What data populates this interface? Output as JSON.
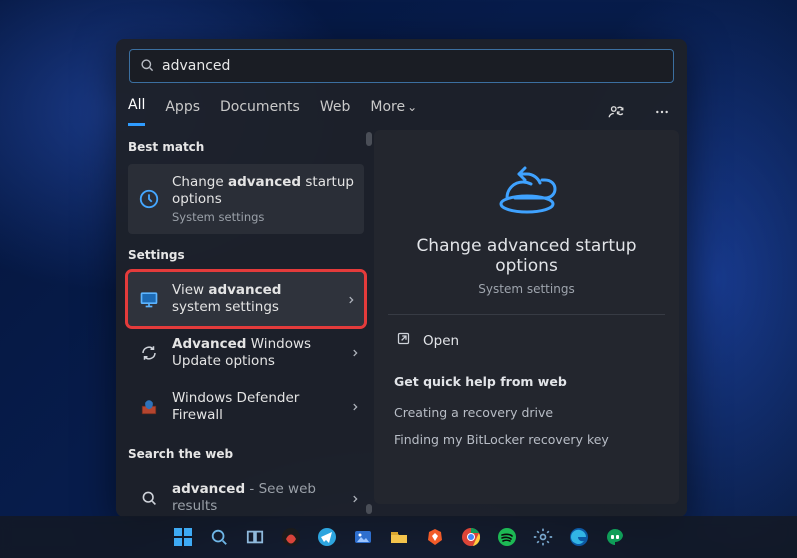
{
  "search": {
    "query": "advanced"
  },
  "tabs": {
    "items": [
      "All",
      "Apps",
      "Documents",
      "Web",
      "More"
    ],
    "active": 0
  },
  "sections": {
    "best_match": "Best match",
    "settings": "Settings",
    "search_web": "Search the web"
  },
  "results": {
    "best": {
      "title_pre": "Change ",
      "title_bold": "advanced",
      "title_post": " startup options",
      "sub": "System settings"
    },
    "settings": [
      {
        "title_pre": "View ",
        "title_bold": "advanced",
        "title_post": " system settings",
        "sub": ""
      },
      {
        "title_pre": "",
        "title_bold": "Advanced",
        "title_post": " Windows Update options",
        "sub": ""
      },
      {
        "title_pre": "Windows Defender Firewall",
        "title_bold": "",
        "title_post": "",
        "sub": ""
      }
    ],
    "web": {
      "title_bold": "advanced",
      "title_post": " - See web results"
    }
  },
  "details": {
    "title": "Change advanced startup options",
    "sub": "System settings",
    "open_label": "Open",
    "help_header": "Get quick help from web",
    "help_links": [
      "Creating a recovery drive",
      "Finding my BitLocker recovery key"
    ]
  },
  "taskbar": {
    "items": [
      "start",
      "search",
      "task-view",
      "app-swirl",
      "telegram",
      "photos",
      "files",
      "brave",
      "chrome",
      "spotify",
      "settings",
      "edge",
      "hangouts"
    ]
  }
}
